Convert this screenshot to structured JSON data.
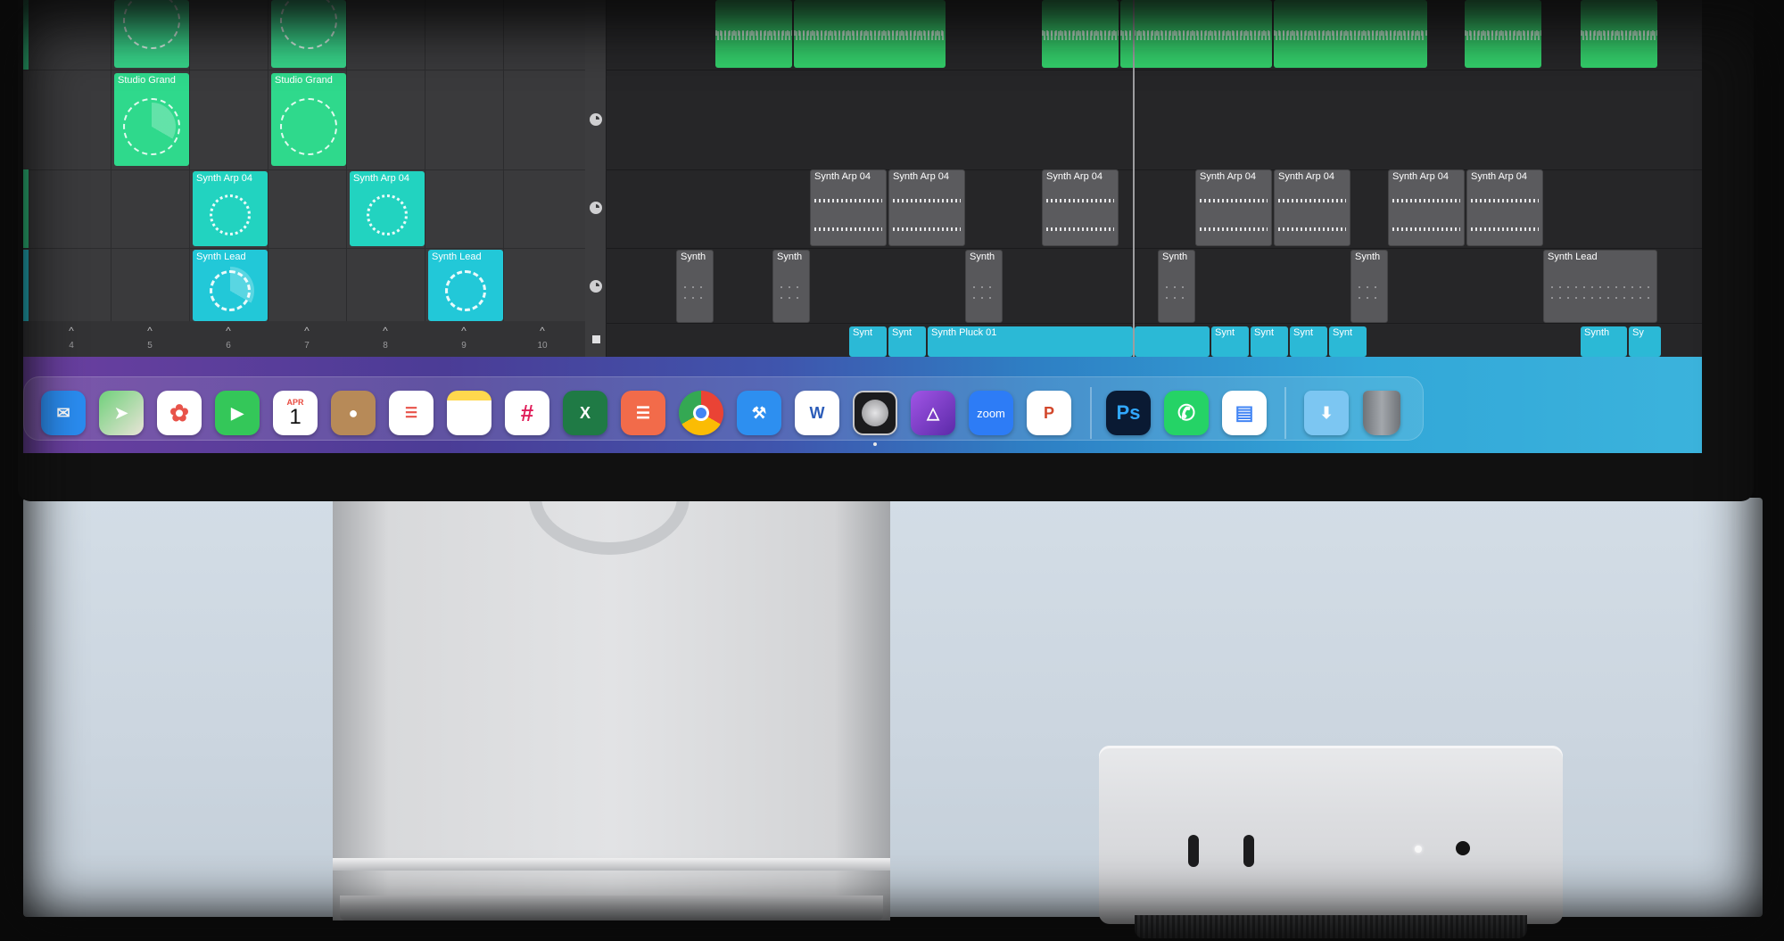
{
  "live_loops": {
    "row1_cells": [
      {
        "label": "Studio Grand"
      },
      {
        "label": "Studio Grand"
      }
    ],
    "row2_cells": [
      {
        "label": "Synth Arp 04"
      },
      {
        "label": "Synth Arp 04"
      }
    ],
    "row3_cells": [
      {
        "label": "Synth Lead"
      },
      {
        "label": "Synth Lead"
      }
    ],
    "column_numbers": [
      "4",
      "5",
      "6",
      "7",
      "8",
      "9",
      "10"
    ]
  },
  "tracks": {
    "arp_regions": [
      "Synth Arp 04",
      "Synth Arp 04",
      "Synth Arp 04",
      "Synth Arp 04",
      "Synth Arp 04",
      "Synth Arp 04",
      "Synth Arp 04"
    ],
    "lead_regions": [
      "Synth",
      "Synth",
      "Synth",
      "Synth",
      "Synth",
      "Synth Lead"
    ],
    "pluck_regions": [
      "Synt",
      "Synt",
      "Synth Pluck 01",
      "Synt",
      "Synt",
      "Synt",
      "Synt",
      "Synth",
      "Sy"
    ]
  },
  "dock": {
    "apps": [
      {
        "name": "Mail",
        "icon": "mail-icon",
        "color": "#2a8cf0"
      },
      {
        "name": "Maps",
        "icon": "maps-icon",
        "color": "#5bc26a"
      },
      {
        "name": "Photos",
        "icon": "photos-icon",
        "color": "#ffffff"
      },
      {
        "name": "FaceTime",
        "icon": "facetime-icon",
        "color": "#34c759"
      },
      {
        "name": "Calendar",
        "icon": "calendar-icon",
        "color": "#ffffff"
      },
      {
        "name": "Contacts",
        "icon": "contacts-icon",
        "color": "#b78a58"
      },
      {
        "name": "Reminders",
        "icon": "reminders-icon",
        "color": "#ffffff"
      },
      {
        "name": "Notes",
        "icon": "notes-icon",
        "color": "#ffd84d"
      },
      {
        "name": "Slack",
        "icon": "slack-icon",
        "color": "#ffffff"
      },
      {
        "name": "Excel",
        "icon": "excel-icon",
        "color": "#1f7a45"
      },
      {
        "name": "Speeko",
        "icon": "speech-icon",
        "color": "#f26b4a"
      },
      {
        "name": "Chrome",
        "icon": "chrome-icon",
        "color": "#ffffff"
      },
      {
        "name": "Xcode",
        "icon": "xcode-icon",
        "color": "#2d8ff0"
      },
      {
        "name": "Word",
        "icon": "word-icon",
        "color": "#ffffff"
      },
      {
        "name": "Logic Pro",
        "icon": "logic-icon",
        "color": "#2b2b2d"
      },
      {
        "name": "Affinity Photo",
        "icon": "affinity-icon",
        "color": "#8a4bd6"
      },
      {
        "name": "Zoom",
        "icon": "zoom-icon",
        "color": "#2d7cf6"
      },
      {
        "name": "PowerPoint",
        "icon": "powerpoint-icon",
        "color": "#ffffff"
      },
      {
        "name": "Photoshop",
        "icon": "photoshop-icon",
        "color": "#0a1a33"
      },
      {
        "name": "WhatsApp",
        "icon": "whatsapp-icon",
        "color": "#25d366"
      },
      {
        "name": "Google Docs",
        "icon": "docs-icon",
        "color": "#ffffff"
      },
      {
        "name": "Downloads",
        "icon": "downloads-folder-icon",
        "color": "#7cc6f2"
      },
      {
        "name": "Trash",
        "icon": "trash-icon",
        "color": "#8a8e94"
      }
    ],
    "calendar_month": "APR",
    "calendar_day": "1",
    "zoom_label": "zoom",
    "photoshop_label": "Ps"
  }
}
